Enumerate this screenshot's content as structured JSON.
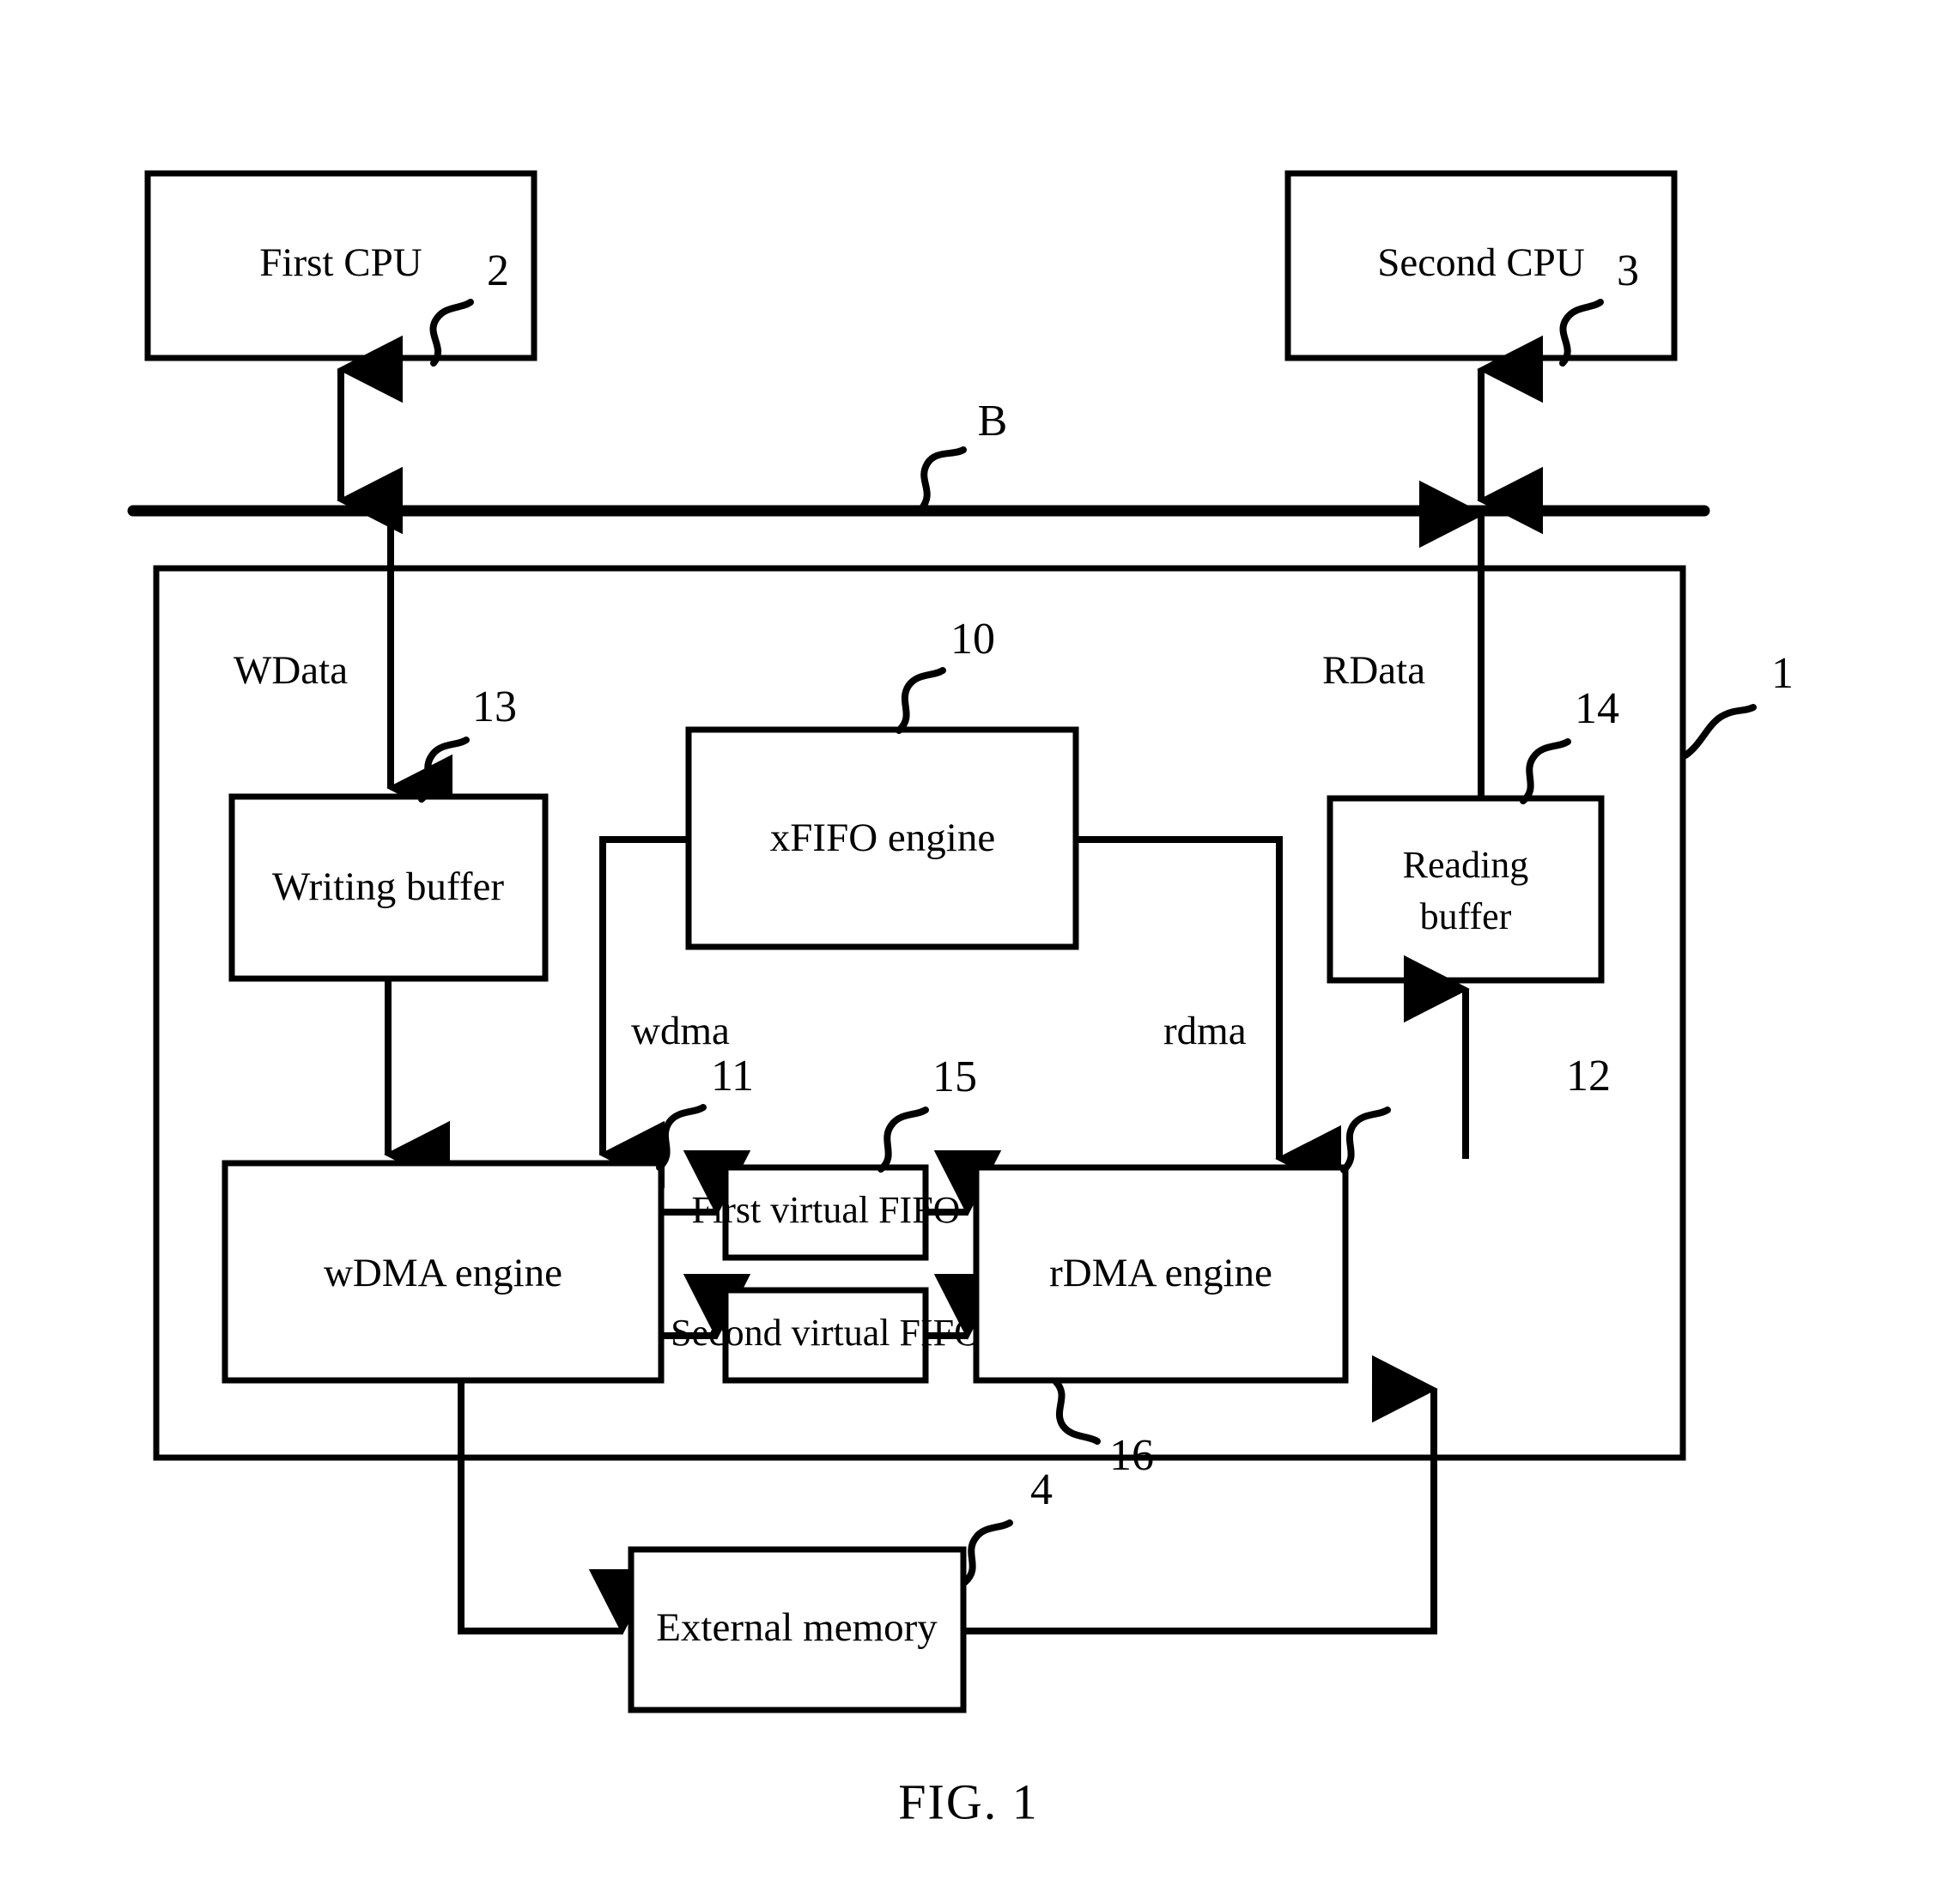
{
  "figure": {
    "caption": "FIG. 1",
    "blocks": {
      "first_cpu": "First CPU",
      "second_cpu": "Second CPU",
      "writing_buffer": "Writing buffer",
      "xfifo_engine": "xFIFO engine",
      "reading_buffer_line1": "Reading",
      "reading_buffer_line2": "buffer",
      "wdma_engine": "wDMA engine",
      "first_virtual_fifo": "First virtual FIFO",
      "second_virtual_fifo": "Second virtual FIFO",
      "rdma_engine": "rDMA engine",
      "external_memory": "External memory"
    },
    "signals": {
      "wdata": "WData",
      "rdata": "RData",
      "wdma": "wdma",
      "rdma": "rdma",
      "bus": "B"
    },
    "reference_numerals": {
      "first_cpu": "2",
      "second_cpu": "3",
      "bus": "B",
      "system": "1",
      "xfifo_engine": "10",
      "wdma_engine": "11",
      "rdma_engine": "12",
      "writing_buffer": "13",
      "reading_buffer": "14",
      "first_virtual_fifo": "15",
      "second_virtual_fifo": "16",
      "external_memory": "4"
    },
    "colors": {
      "stroke": "#000000",
      "background": "#ffffff"
    }
  }
}
